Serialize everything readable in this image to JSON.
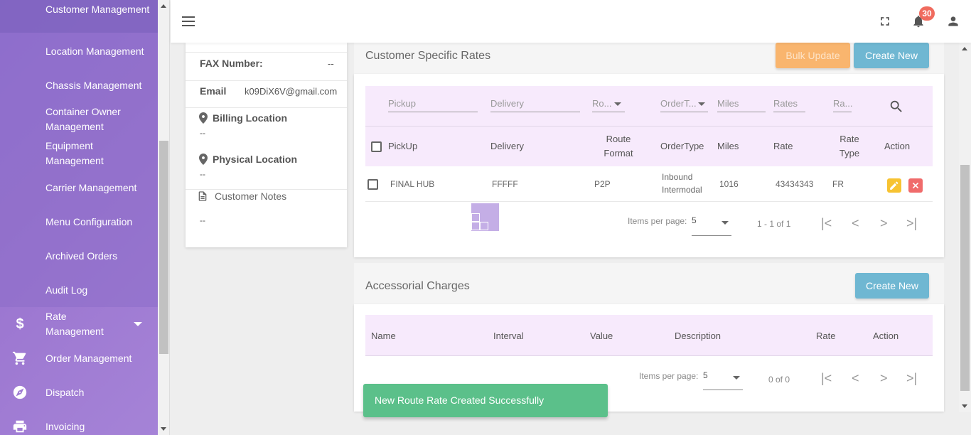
{
  "sidebar": {
    "items": [
      {
        "label": "Customer Management"
      },
      {
        "label": "Location Management"
      },
      {
        "label": "Chassis Management"
      },
      {
        "label": "Container Owner Management"
      },
      {
        "label": "Equipment Management"
      },
      {
        "label": "Carrier Management"
      },
      {
        "label": "Menu Configuration"
      },
      {
        "label": "Archived Orders"
      },
      {
        "label": "Audit Log"
      },
      {
        "label": "Rate Management",
        "icon": "dollar-icon"
      },
      {
        "label": "Order Management",
        "icon": "cart-icon"
      },
      {
        "label": "Dispatch",
        "icon": "compass-icon"
      },
      {
        "label": "Invoicing",
        "icon": "printer-icon"
      }
    ]
  },
  "header": {
    "notification_count": "30",
    "icons": [
      "menu-icon",
      "fullscreen-icon",
      "bell-icon",
      "account-icon"
    ]
  },
  "customer_card": {
    "fax_label": "FAX Number:",
    "fax_value": "--",
    "email_label": "Email",
    "email_value": "k09DiX6V@gmail.com",
    "billing_label": "Billing Location",
    "billing_value": "--",
    "physical_label": "Physical Location",
    "physical_value": "--",
    "notes_label": "Customer Notes",
    "notes_value": "--"
  },
  "customer_rates": {
    "title": "Customer Specific Rates",
    "bulk_update_label": "Bulk Update",
    "create_new_label": "Create New",
    "filters": {
      "pickup": "Pickup",
      "delivery": "Delivery",
      "route": "Ro...",
      "order_type": "OrderT...",
      "miles": "Miles",
      "rates": "Rates",
      "rate_type": "Ra..."
    },
    "columns": {
      "pickup": "PickUp",
      "delivery": "Delivery",
      "route_format": "Route Format",
      "order_type": "OrderType",
      "miles": "Miles",
      "rate": "Rate",
      "rate_type": "Rate Type",
      "action": "Action"
    },
    "rows": [
      {
        "pickup": "FINAL HUB",
        "delivery": "FFFFF",
        "route_format": "P2P",
        "order_type": "Inbound Intermodal",
        "miles": "1016",
        "rate": "43434343",
        "rate_type": "FR"
      }
    ],
    "pagination": {
      "items_per_page_label": "Items per page:",
      "items_per_page_value": "5",
      "range": "1 - 1 of 1"
    }
  },
  "accessorial": {
    "title": "Accessorial Charges",
    "create_new_label": "Create New",
    "columns": {
      "name": "Name",
      "interval": "Interval",
      "value": "Value",
      "description": "Description",
      "rate": "Rate",
      "action": "Action"
    },
    "pagination": {
      "items_per_page_label": "Items per page:",
      "items_per_page_value": "5",
      "range": "0 of 0"
    }
  },
  "snackbar": {
    "message": "New Route Rate Created Successfully"
  },
  "colors": {
    "sidebar": "#9a74cf",
    "table_head": "#f7eafc",
    "create_button": "#6fb7d2",
    "bulk_button": "#f9b56e",
    "snackbar": "#5bc08a",
    "badge": "#f06b5e"
  }
}
